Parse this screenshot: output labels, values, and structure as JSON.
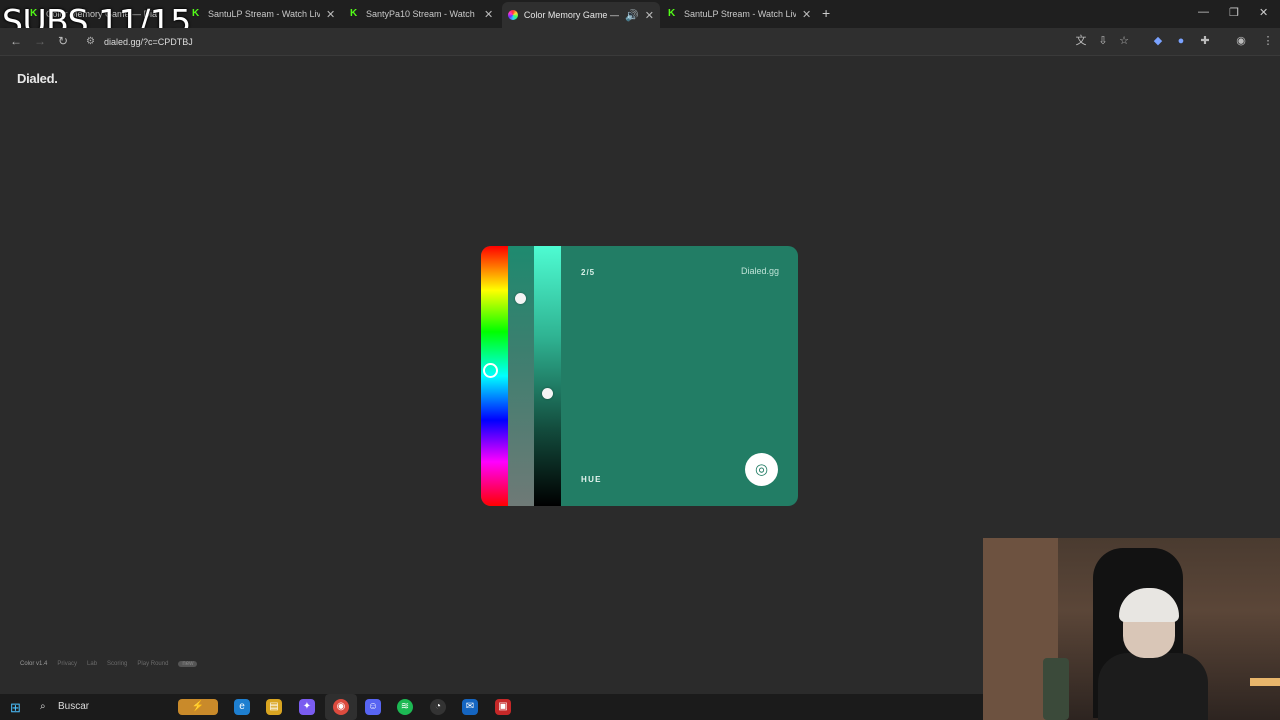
{
  "overlay": {
    "subs_text": "SUBS 11/15"
  },
  "browser": {
    "tabs": [
      {
        "title": "Color Memory Game — Dia",
        "icon": "kick-icon",
        "active": false
      },
      {
        "title": "SantuLP Stream - Watch Live on",
        "icon": "kick-icon",
        "active": false
      },
      {
        "title": "SantyPa10 Stream - Watch Live",
        "icon": "kick-icon",
        "active": false
      },
      {
        "title": "Color Memory Game — Ho",
        "icon": "color-wheel-icon",
        "active": true
      },
      {
        "title": "SantuLP Stream - Watch Live on",
        "icon": "kick-icon",
        "active": false
      }
    ],
    "url": "dialed.gg/?c=CPDTBJ"
  },
  "page": {
    "logo": "Dialed.",
    "game": {
      "round": "2/5",
      "brand": "Dialed.gg",
      "mode_label": "HUE",
      "current_color": "#227d65"
    },
    "footer": {
      "version": "Color v1.4",
      "links": [
        "Privacy",
        "Lab",
        "Scoring",
        "Play Round"
      ],
      "tag": "new"
    }
  },
  "taskbar": {
    "search_placeholder": "Buscar"
  }
}
